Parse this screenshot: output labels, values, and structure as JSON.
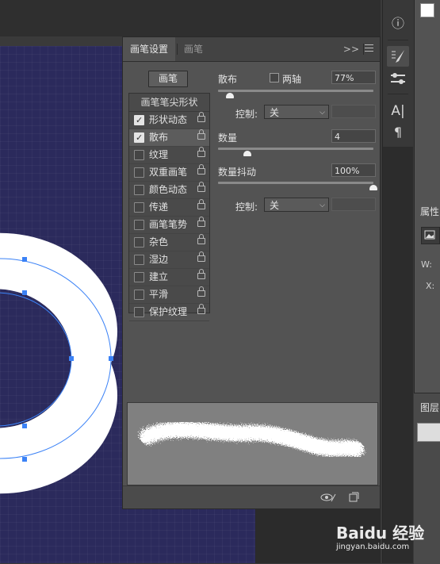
{
  "panel": {
    "tabs": [
      "画笔设置",
      "画笔"
    ],
    "collapse_glyph": ">>",
    "brush_button": "画笔",
    "list_header": "画笔笔尖形状",
    "items": [
      {
        "label": "形状动态",
        "checked": true
      },
      {
        "label": "散布",
        "checked": true
      },
      {
        "label": "纹理",
        "checked": false
      },
      {
        "label": "双重画笔",
        "checked": false
      },
      {
        "label": "颜色动态",
        "checked": false
      },
      {
        "label": "传递",
        "checked": false
      },
      {
        "label": "画笔笔势",
        "checked": false
      },
      {
        "label": "杂色",
        "checked": false
      },
      {
        "label": "湿边",
        "checked": false
      },
      {
        "label": "建立",
        "checked": false
      },
      {
        "label": "平滑",
        "checked": false
      },
      {
        "label": "保护纹理",
        "checked": false
      }
    ],
    "selected_index": 1
  },
  "settings": {
    "scatter_label": "散布",
    "both_axes_label": "两轴",
    "both_axes_checked": false,
    "scatter_value": "77%",
    "control_label": "控制:",
    "control_value": "关",
    "count_label": "数量",
    "count_value": "4",
    "count_jitter_label": "数量抖动",
    "count_jitter_value": "100%",
    "control2_label": "控制:",
    "control2_value": "关"
  },
  "sliders": {
    "scatter_fraction": 0.077,
    "count_fraction": 0.19,
    "count_jitter_fraction": 1.0
  },
  "right": {
    "properties_title": "属性",
    "layers_title": "图层",
    "w_label": "W:",
    "x_label": "X:"
  },
  "watermark": {
    "logo": "Baidu 经验",
    "url": "jingyan.baidu.com"
  },
  "colors": {
    "canvas": "#2b2a5c",
    "panel": "#535353",
    "selection": "#3b82f6"
  },
  "icons": [
    "info-icon",
    "brush-settings-icon",
    "brush-tool-presets-icon",
    "character-icon",
    "paragraph-icon",
    "chevron-down-icon",
    "lock-icon",
    "create-new-brush-icon",
    "toggle-preview-icon",
    "panel-menu-icon"
  ]
}
